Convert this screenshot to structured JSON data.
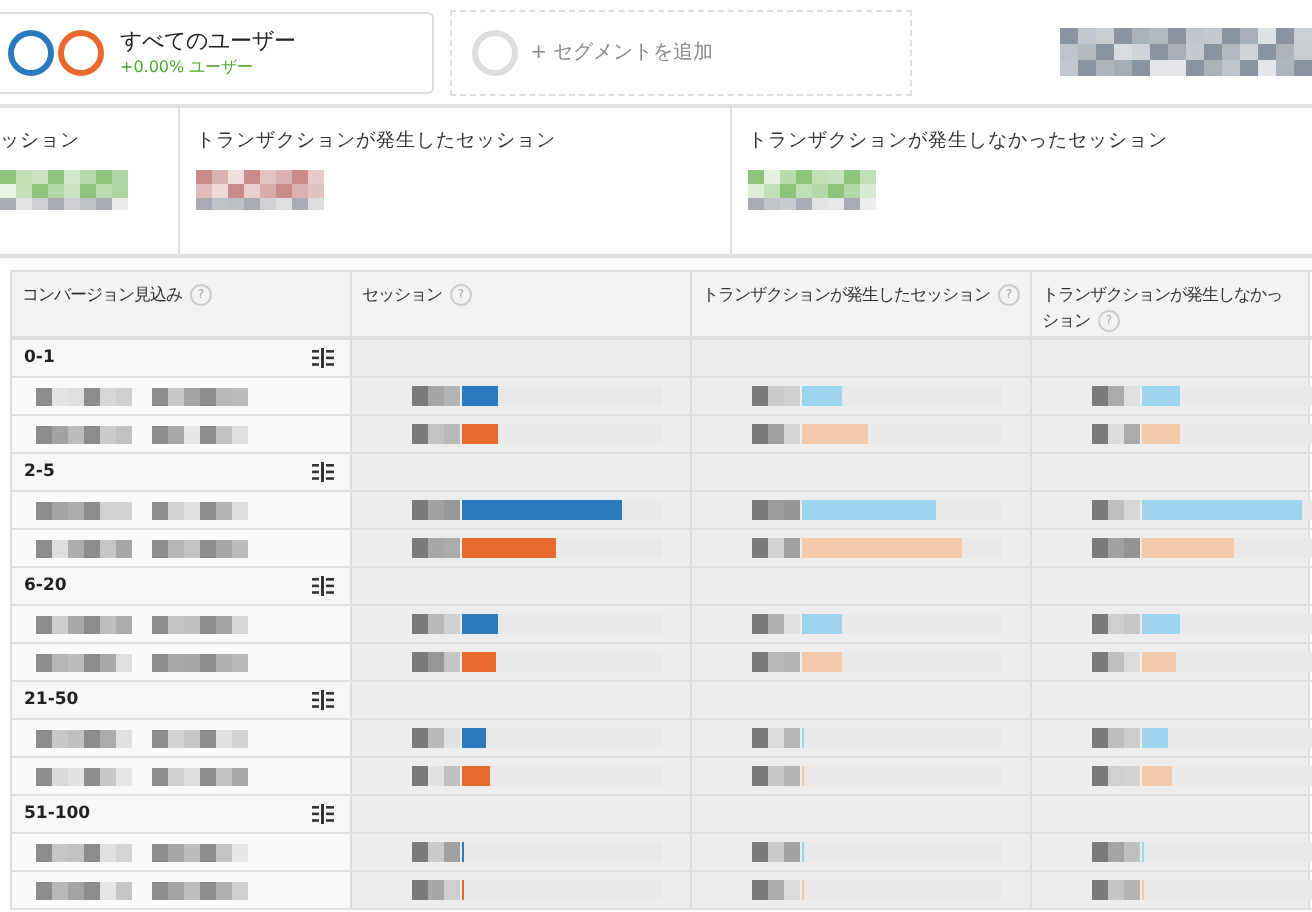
{
  "segments": [
    {
      "title": "すべてのユーザー",
      "subtitle": "+0.00% ユーザー",
      "circles": [
        {
          "color": "#2a7abf"
        },
        {
          "color": "#e8692d"
        }
      ]
    }
  ],
  "add_segment": {
    "label": "+ セグメントを追加"
  },
  "date_range": {
    "blurred": true
  },
  "summary": [
    {
      "label": "ッション",
      "color": "#8cc47a"
    },
    {
      "label": "トランザクションが発生したセッション",
      "color": "#c98a8a"
    },
    {
      "label": "トランザクションが発生しなかったセッション",
      "color": "#8cc47a"
    }
  ],
  "table": {
    "columns": [
      {
        "label_lines": [
          "コンバージョン見込み"
        ],
        "help": "?"
      },
      {
        "label_lines": [
          "セッション"
        ],
        "help": "?"
      },
      {
        "label_lines": [
          "トランザクションが発生したセッション"
        ],
        "help": "?"
      },
      {
        "label_lines": [
          "トランザクションが発生しなかっ",
          "ション"
        ],
        "help": "?"
      }
    ],
    "groups": [
      {
        "label": "0-1",
        "pivot": true,
        "rows": [
          {
            "blurred_label": true,
            "cells": [
              {
                "blurred": true,
                "level": 0.18,
                "color": "#2a7abf"
              },
              {
                "blurred": true,
                "level": 0.2,
                "color": "#9dd5ef"
              },
              {
                "blurred": true,
                "level": 0.19,
                "color": "#9dd5ef"
              }
            ]
          },
          {
            "blurred_label": true,
            "cells": [
              {
                "blurred": true,
                "level": 0.18,
                "color": "#e8692d"
              },
              {
                "blurred": true,
                "level": 0.33,
                "color": "#f2c9a9"
              },
              {
                "blurred": true,
                "level": 0.19,
                "color": "#f2c9a9"
              }
            ]
          }
        ]
      },
      {
        "label": "2-5",
        "pivot": true,
        "rows": [
          {
            "blurred_label": true,
            "cells": [
              {
                "blurred": true,
                "level": 0.8,
                "color": "#2a7abf"
              },
              {
                "blurred": true,
                "level": 0.67,
                "color": "#9dd5ef"
              },
              {
                "blurred": true,
                "level": 0.8,
                "color": "#9dd5ef"
              }
            ]
          },
          {
            "blurred_label": true,
            "cells": [
              {
                "blurred": true,
                "level": 0.47,
                "color": "#e8692d"
              },
              {
                "blurred": true,
                "level": 0.8,
                "color": "#f2c9a9"
              },
              {
                "blurred": true,
                "level": 0.46,
                "color": "#f2c9a9"
              }
            ]
          }
        ]
      },
      {
        "label": "6-20",
        "pivot": true,
        "rows": [
          {
            "blurred_label": true,
            "cells": [
              {
                "blurred": true,
                "level": 0.18,
                "color": "#2a7abf"
              },
              {
                "blurred": true,
                "level": 0.2,
                "color": "#9dd5ef"
              },
              {
                "blurred": true,
                "level": 0.19,
                "color": "#9dd5ef"
              }
            ]
          },
          {
            "blurred_label": true,
            "cells": [
              {
                "blurred": true,
                "level": 0.17,
                "color": "#e8692d"
              },
              {
                "blurred": true,
                "level": 0.2,
                "color": "#f2c9a9"
              },
              {
                "blurred": true,
                "level": 0.17,
                "color": "#f2c9a9"
              }
            ]
          }
        ]
      },
      {
        "label": "21-50",
        "pivot": true,
        "rows": [
          {
            "blurred_label": true,
            "cells": [
              {
                "blurred": true,
                "level": 0.12,
                "color": "#2a7abf"
              },
              {
                "blurred": true,
                "level": 0.01,
                "color": "#9dd5ef"
              },
              {
                "blurred": true,
                "level": 0.13,
                "color": "#9dd5ef"
              }
            ]
          },
          {
            "blurred_label": true,
            "cells": [
              {
                "blurred": true,
                "level": 0.14,
                "color": "#e8692d"
              },
              {
                "blurred": true,
                "level": 0.01,
                "color": "#f2c9a9"
              },
              {
                "blurred": true,
                "level": 0.15,
                "color": "#f2c9a9"
              }
            ]
          }
        ]
      },
      {
        "label": "51-100",
        "pivot": true,
        "rows": [
          {
            "blurred_label": true,
            "cells": [
              {
                "blurred": true,
                "level": 0.01,
                "color": "#2a7abf"
              },
              {
                "blurred": true,
                "level": 0.01,
                "color": "#9dd5ef"
              },
              {
                "blurred": true,
                "level": 0.01,
                "color": "#9dd5ef"
              }
            ]
          },
          {
            "blurred_label": true,
            "cells": [
              {
                "blurred": true,
                "level": 0.01,
                "color": "#e8692d"
              },
              {
                "blurred": true,
                "level": 0.01,
                "color": "#f2c9a9"
              },
              {
                "blurred": true,
                "level": 0.01,
                "color": "#f2c9a9"
              }
            ]
          }
        ]
      }
    ]
  }
}
